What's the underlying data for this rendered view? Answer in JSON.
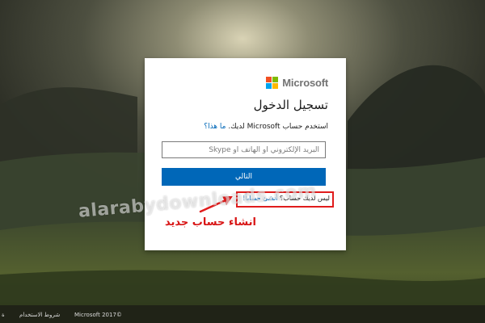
{
  "brand": {
    "name": "Microsoft",
    "colors": [
      "#f25022",
      "#7fba00",
      "#00a4ef",
      "#ffb900"
    ]
  },
  "signin": {
    "title": "تسجيل الدخول",
    "subtitle": "استخدم حساب Microsoft لديك.",
    "help_link": "ما هذا؟",
    "email_placeholder": "البريد الإلكتروني أو الهاتف أو Skype",
    "next_button": "التالي",
    "no_account_text": "ليس لديك حساب؟",
    "create_link": "أنشئ حساباً!"
  },
  "annotation": {
    "text": "انشاء حساب جديد"
  },
  "watermark": {
    "text": "alarabydownloads.com"
  },
  "footer": {
    "copyright": "Microsoft 2017©",
    "terms": "شروط الاستخدام",
    "edge_mark": "ة"
  },
  "colors": {
    "primary": "#0067b8",
    "annotation": "#e01c1c"
  }
}
